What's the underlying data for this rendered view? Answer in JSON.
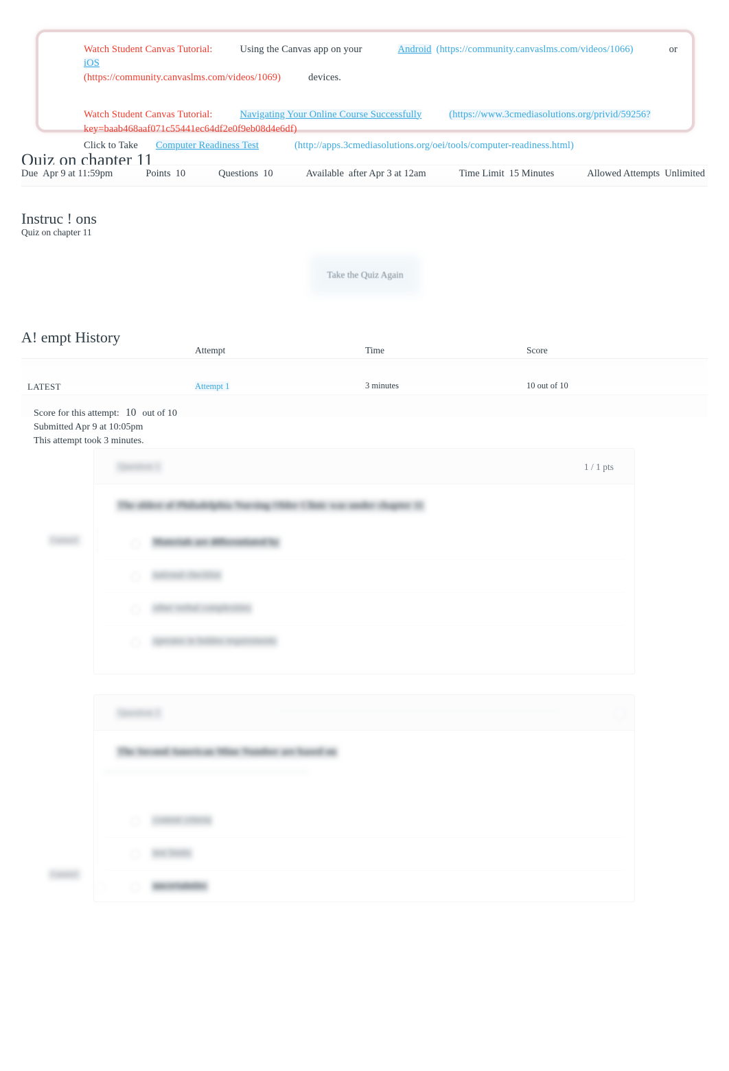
{
  "banner": {
    "line1": {
      "label": "Watch Student Canvas Tutorial:",
      "text_a": "Using the Canvas app on your",
      "link_android": "Android",
      "url_android": "(https://community.canvaslms.com/videos/1066)",
      "conj": "or",
      "link_ios": "iOS",
      "url_ios": "(https://community.canvaslms.com/videos/1069)",
      "text_b": "devices."
    },
    "line2": {
      "label": "Watch Student Canvas Tutorial:",
      "link": "Navigating Your Online Course Successfully",
      "url_part1": "(https://www.3cmediasolutions.org/privid/59256?",
      "url_part2": "key=baab468aaf071c55441ec64df2e0f9eb08d4e6df)"
    },
    "line3": {
      "prefix": "Click to Take",
      "link": "Computer Readiness Test",
      "url": "(http://apps.3cmediasolutions.org/oei/tools/computer-readiness.html)"
    },
    "colors": {
      "label_red": "#f0392b",
      "link_blue": "#37a8e0",
      "border": "#e8d4d6"
    }
  },
  "quiz": {
    "title": "Quiz on chapter 11",
    "meta": [
      {
        "label": "Due",
        "value": "Apr 9 at 11:59pm"
      },
      {
        "label": "Points",
        "value": "10"
      },
      {
        "label": "Questions",
        "value": "10"
      },
      {
        "label": "Available",
        "value": "after Apr 3 at 12am"
      },
      {
        "label": "Time Limit",
        "value": "15 Minutes"
      },
      {
        "label": "Allowed Attempts",
        "value": "Unlimited"
      }
    ]
  },
  "instructions": {
    "heading": "Instruc ! ons",
    "body": "Quiz on chapter 11"
  },
  "retake": {
    "label": "Take the Quiz Again"
  },
  "attempt_history": {
    "heading": "A! empt History",
    "columns": [
      "",
      "Attempt",
      "Time",
      "Score"
    ],
    "rows": [
      {
        "flag": "LATEST",
        "attempt": "Attempt 1",
        "time": "3 minutes",
        "score": "10 out of 10"
      }
    ]
  },
  "score_summary": {
    "score_label": "Score for this attempt:",
    "score_value": "10",
    "score_out_of": "out of 10",
    "submitted": "Submitted Apr 9 at 10:05pm",
    "duration": "This attempt took 3 minutes."
  },
  "questions": [
    {
      "title": "Question 1",
      "points": "1 / 1 pts",
      "points_visible": true,
      "correct_tag": "Correct!",
      "text": "The oldest of Philadelphia Nursing Older Clinic was under chapter 11",
      "answers": [
        {
          "text": "Materials are differentiated by",
          "chosen": true
        },
        {
          "text": "national checklist",
          "chosen": false
        },
        {
          "text": "other verbal complexities",
          "chosen": false
        },
        {
          "text": "operates in hidden requirements",
          "chosen": false
        }
      ]
    },
    {
      "title": "Question 2",
      "points": "",
      "points_visible": false,
      "correct_tag": "Correct!",
      "text": "The Second American Mine Number are based on",
      "answers": [
        {
          "text": "content criteria",
          "chosen": false
        },
        {
          "text": "test limits",
          "chosen": false
        },
        {
          "text": "uncertainties",
          "chosen": true
        }
      ]
    }
  ]
}
